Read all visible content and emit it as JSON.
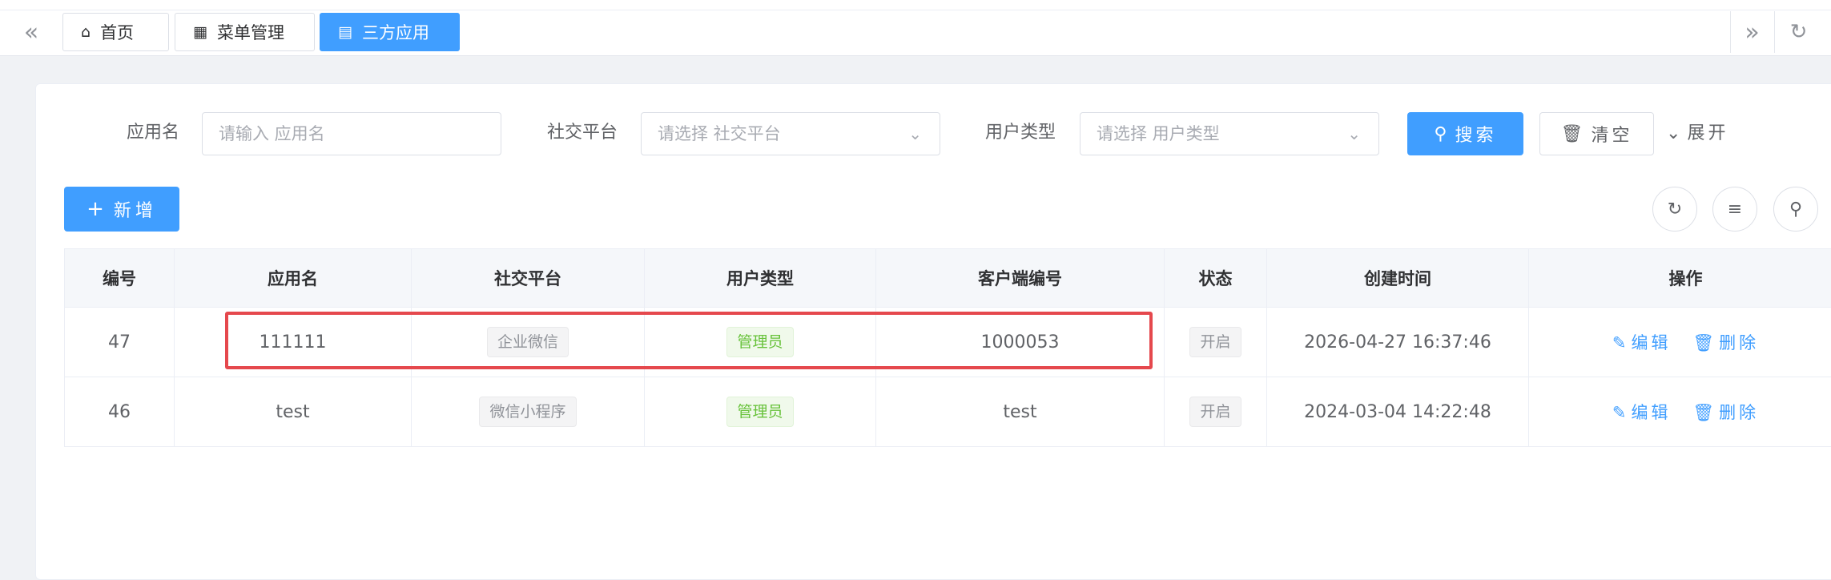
{
  "tabs": [
    {
      "label": "首页",
      "icon": "home-icon"
    },
    {
      "label": "菜单管理",
      "icon": "grid-icon"
    },
    {
      "label": "三方应用",
      "icon": "document-icon",
      "active": true
    }
  ],
  "search": {
    "app_name_label": "应用名",
    "app_name_placeholder": "请输入 应用名",
    "platform_label": "社交平台",
    "platform_placeholder": "请选择 社交平台",
    "user_type_label": "用户类型",
    "user_type_placeholder": "请选择 用户类型",
    "search_button": "搜索",
    "clear_button": "清空",
    "expand_label": "展开"
  },
  "toolbar": {
    "add_button": "新增"
  },
  "table": {
    "columns": [
      "编号",
      "应用名",
      "社交平台",
      "用户类型",
      "客户端编号",
      "状态",
      "创建时间",
      "操作"
    ],
    "rows": [
      {
        "id": "47",
        "name": "111111",
        "platform": "企业微信",
        "user_type": "管理员",
        "client_id": "1000053",
        "status": "开启",
        "created": "2026-04-27 16:37:46"
      },
      {
        "id": "46",
        "name": "test",
        "platform": "微信小程序",
        "user_type": "管理员",
        "client_id": "test",
        "status": "开启",
        "created": "2024-03-04 14:22:48"
      }
    ],
    "actions": {
      "edit": "编辑",
      "delete": "删除"
    }
  },
  "colors": {
    "primary": "#409eff",
    "highlight": "#e5484d"
  }
}
